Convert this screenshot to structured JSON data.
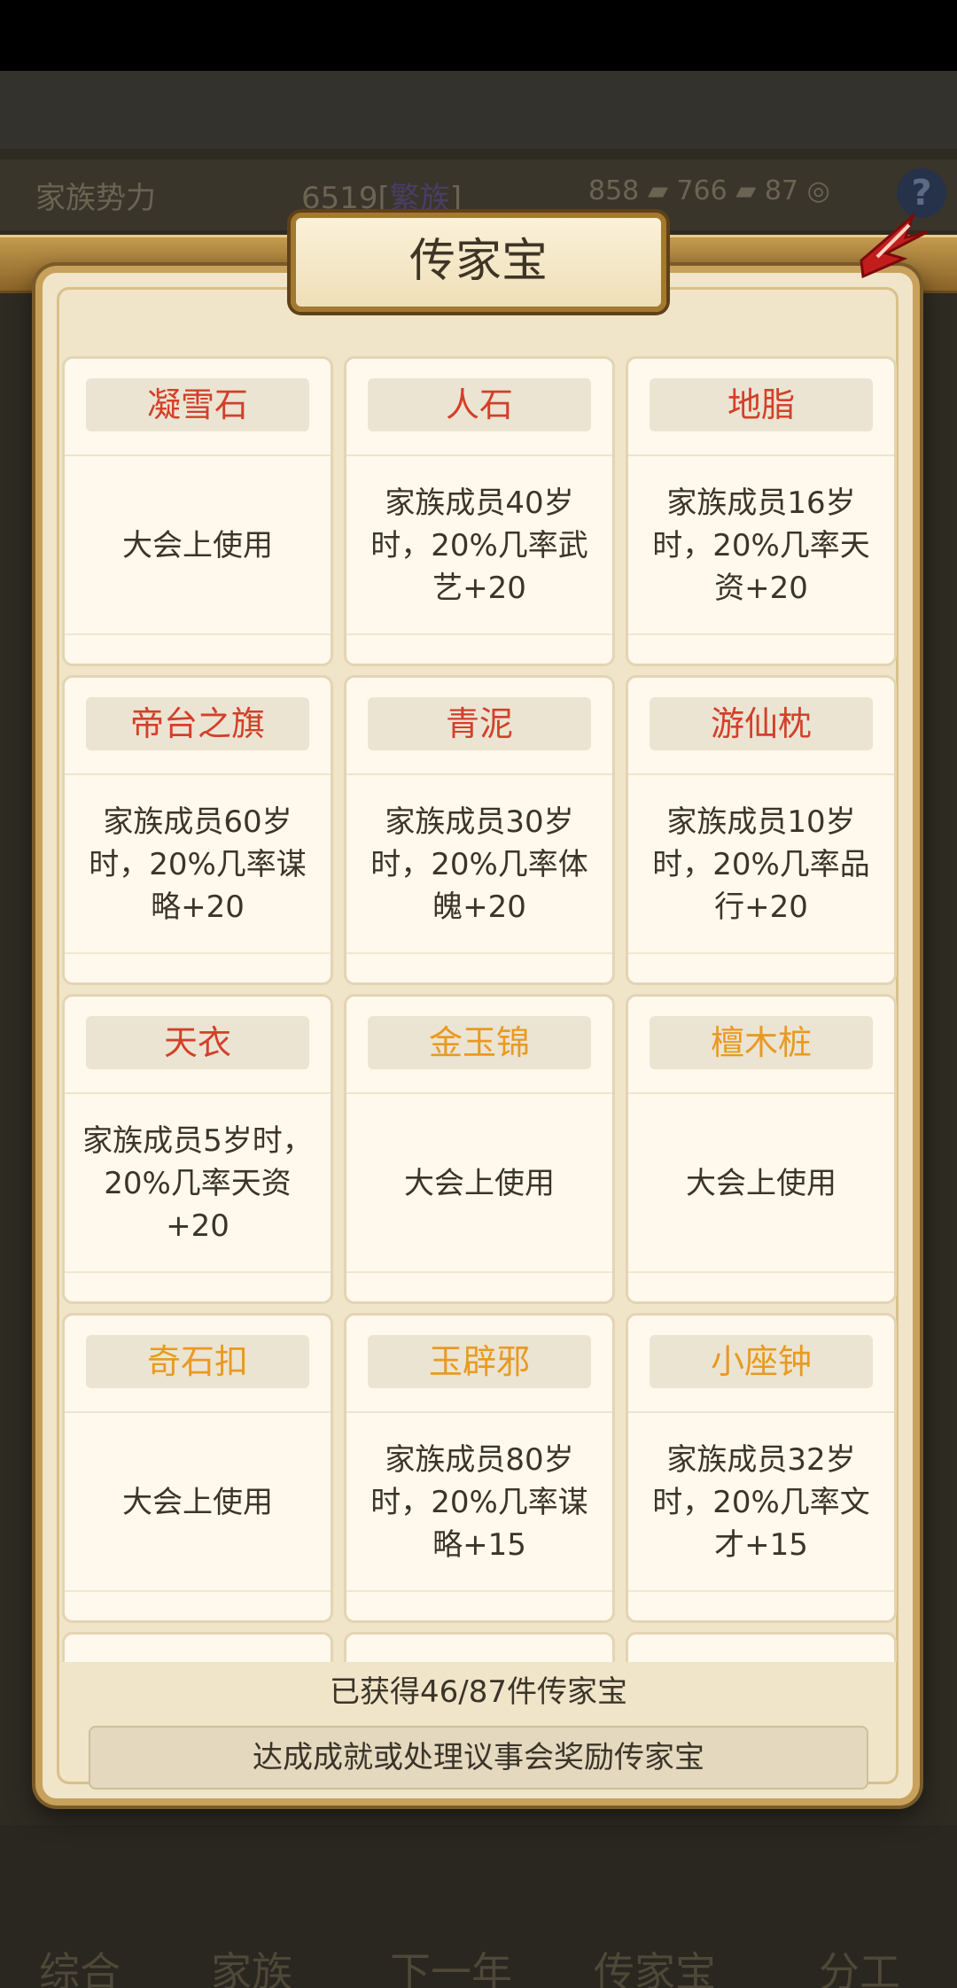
{
  "background": {
    "power_label": "家族势力",
    "power_value": "6519",
    "power_tag": "繁族",
    "res_silver": "858",
    "res_iron": "766",
    "res_coin": "87",
    "help_icon": "question-icon",
    "nav": [
      "综合",
      "家族",
      "下一年",
      "传家宝",
      "分工"
    ]
  },
  "modal": {
    "title": "传家宝",
    "close_icon": "close-icon",
    "items": [
      {
        "name": "凝雪石",
        "desc": "大会上使用",
        "color": "#d2402a"
      },
      {
        "name": "人石",
        "desc": "家族成员40岁时，20%几率武艺+20",
        "color": "#d2402a"
      },
      {
        "name": "地脂",
        "desc": "家族成员16岁时，20%几率天资+20",
        "color": "#d2402a"
      },
      {
        "name": "帝台之旗",
        "desc": "家族成员60岁时，20%几率谋略+20",
        "color": "#d2402a"
      },
      {
        "name": "青泥",
        "desc": "家族成员30岁时，20%几率体魄+20",
        "color": "#d2402a"
      },
      {
        "name": "游仙枕",
        "desc": "家族成员10岁时，20%几率品行+20",
        "color": "#d2402a"
      },
      {
        "name": "天衣",
        "desc": "家族成员5岁时，20%几率天资+20",
        "color": "#d2402a"
      },
      {
        "name": "金玉锦",
        "desc": "大会上使用",
        "color": "#e89a22"
      },
      {
        "name": "檀木桩",
        "desc": "大会上使用",
        "color": "#e89a22"
      },
      {
        "name": "奇石扣",
        "desc": "大会上使用",
        "color": "#e89a22"
      },
      {
        "name": "玉辟邪",
        "desc": "家族成员80岁时，20%几率谋略+15",
        "color": "#e89a22"
      },
      {
        "name": "小座钟",
        "desc": "家族成员32岁时，20%几率文才+15",
        "color": "#e89a22"
      }
    ],
    "count_text": "已获得46/87件传家宝",
    "reward_button": "达成成就或处理议事会奖励传家宝"
  }
}
